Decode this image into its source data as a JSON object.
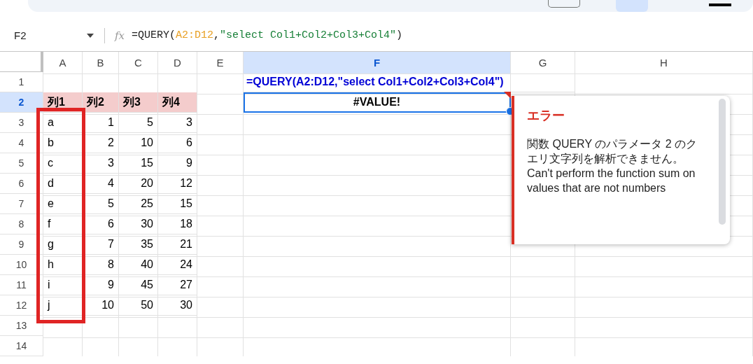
{
  "toolbar": {
    "bold_selected": true
  },
  "formula_bar": {
    "cell_ref": "F2",
    "function_label": "fx",
    "formula_parts": [
      {
        "kind": "plain",
        "text": "=QUERY("
      },
      {
        "kind": "range",
        "text": "A2:D12"
      },
      {
        "kind": "plain",
        "text": ","
      },
      {
        "kind": "string",
        "text": "\"select Col1+Col2+Col3+Col4\""
      },
      {
        "kind": "plain",
        "text": ")"
      }
    ]
  },
  "grid": {
    "columns": [
      {
        "label": "A",
        "selected": false
      },
      {
        "label": "B",
        "selected": false
      },
      {
        "label": "C",
        "selected": false
      },
      {
        "label": "D",
        "selected": false
      },
      {
        "label": "E",
        "selected": false
      },
      {
        "label": "F",
        "selected": true
      },
      {
        "label": "G",
        "selected": false
      },
      {
        "label": "H",
        "selected": false
      }
    ],
    "rows": [
      {
        "label": "1",
        "selected": false,
        "cells": [
          null,
          null,
          null,
          null,
          null,
          {
            "kind": "formula",
            "text": "=QUERY(A2:D12,\"select Col1+Col2+Col3+Col4\")"
          }
        ]
      },
      {
        "label": "2",
        "selected": true,
        "cells": [
          {
            "kind": "header",
            "text": "列1"
          },
          {
            "kind": "header",
            "text": "列2"
          },
          {
            "kind": "header",
            "text": "列3"
          },
          {
            "kind": "header",
            "text": "列4"
          },
          null,
          {
            "kind": "error",
            "text": "#VALUE!"
          }
        ]
      },
      {
        "label": "3",
        "selected": false,
        "cells": [
          {
            "kind": "text",
            "text": "a"
          },
          {
            "kind": "number",
            "text": "1"
          },
          {
            "kind": "number",
            "text": "5"
          },
          {
            "kind": "number",
            "text": "3"
          }
        ]
      },
      {
        "label": "4",
        "selected": false,
        "cells": [
          {
            "kind": "text",
            "text": "b"
          },
          {
            "kind": "number",
            "text": "2"
          },
          {
            "kind": "number",
            "text": "10"
          },
          {
            "kind": "number",
            "text": "6"
          }
        ]
      },
      {
        "label": "5",
        "selected": false,
        "cells": [
          {
            "kind": "text",
            "text": "c"
          },
          {
            "kind": "number",
            "text": "3"
          },
          {
            "kind": "number",
            "text": "15"
          },
          {
            "kind": "number",
            "text": "9"
          }
        ]
      },
      {
        "label": "6",
        "selected": false,
        "cells": [
          {
            "kind": "text",
            "text": "d"
          },
          {
            "kind": "number",
            "text": "4"
          },
          {
            "kind": "number",
            "text": "20"
          },
          {
            "kind": "number",
            "text": "12"
          }
        ]
      },
      {
        "label": "7",
        "selected": false,
        "cells": [
          {
            "kind": "text",
            "text": "e"
          },
          {
            "kind": "number",
            "text": "5"
          },
          {
            "kind": "number",
            "text": "25"
          },
          {
            "kind": "number",
            "text": "15"
          }
        ]
      },
      {
        "label": "8",
        "selected": false,
        "cells": [
          {
            "kind": "text",
            "text": "f"
          },
          {
            "kind": "number",
            "text": "6"
          },
          {
            "kind": "number",
            "text": "30"
          },
          {
            "kind": "number",
            "text": "18"
          }
        ]
      },
      {
        "label": "9",
        "selected": false,
        "cells": [
          {
            "kind": "text",
            "text": "g"
          },
          {
            "kind": "number",
            "text": "7"
          },
          {
            "kind": "number",
            "text": "35"
          },
          {
            "kind": "number",
            "text": "21"
          }
        ]
      },
      {
        "label": "10",
        "selected": false,
        "cells": [
          {
            "kind": "text",
            "text": "h"
          },
          {
            "kind": "number",
            "text": "8"
          },
          {
            "kind": "number",
            "text": "40"
          },
          {
            "kind": "number",
            "text": "24"
          }
        ]
      },
      {
        "label": "11",
        "selected": false,
        "cells": [
          {
            "kind": "text",
            "text": "i"
          },
          {
            "kind": "number",
            "text": "9"
          },
          {
            "kind": "number",
            "text": "45"
          },
          {
            "kind": "number",
            "text": "27"
          }
        ]
      },
      {
        "label": "12",
        "selected": false,
        "cells": [
          {
            "kind": "text",
            "text": "j"
          },
          {
            "kind": "number",
            "text": "10"
          },
          {
            "kind": "number",
            "text": "50"
          },
          {
            "kind": "number",
            "text": "30"
          }
        ]
      },
      {
        "label": "13",
        "selected": false
      },
      {
        "label": "14",
        "selected": false
      }
    ]
  },
  "error_popup": {
    "title": "エラー",
    "message": "関数 QUERY のパラメータ 2 のクエリ文字列を解析できません。Can't perform the function sum on values that are not numbers"
  }
}
